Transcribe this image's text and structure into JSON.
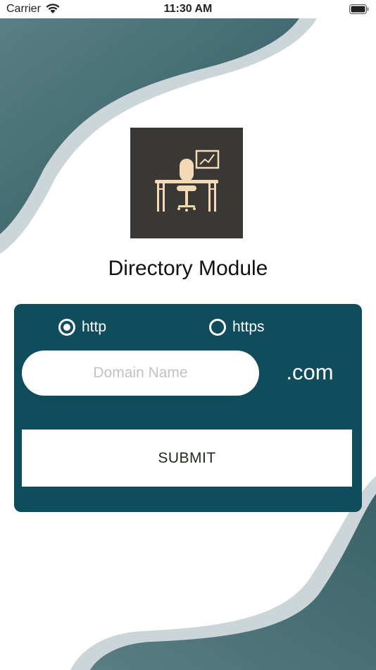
{
  "status_bar": {
    "carrier": "Carrier",
    "time": "11:30 AM"
  },
  "logo": {
    "icon": "office-desk-chair-chart-icon",
    "background": "#3a3835",
    "foreground": "#f3d9b6"
  },
  "title": "Directory Module",
  "form": {
    "protocol_options": [
      {
        "label": "http",
        "selected": true
      },
      {
        "label": "https",
        "selected": false
      }
    ],
    "domain_input": {
      "value": "",
      "placeholder": "Domain Name"
    },
    "tld": ".com",
    "submit_label": "SUBMIT"
  },
  "colors": {
    "card": "#0f4c5c",
    "wave_dark": "#3f6c75",
    "wave_light": "#ccd6d8"
  }
}
